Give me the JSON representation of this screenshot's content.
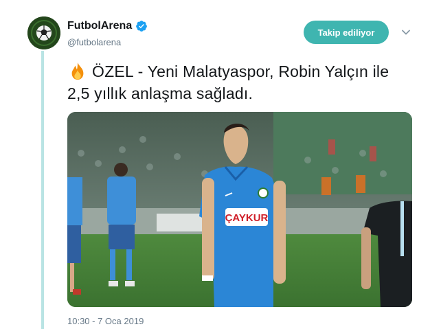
{
  "account": {
    "display_name": "FutbolArena",
    "handle": "@futbolarena",
    "verified": true,
    "avatar_icon": "soccer-ball-icon"
  },
  "actions": {
    "follow_label": "Takip ediliyor",
    "more_icon": "chevron-down-icon"
  },
  "tweet": {
    "emoji_icon": "fire-icon",
    "text": "ÖZEL - Yeni Malatyaspor, Robin Yalçın ile 2,5 yıllık anlaşma sağladı.",
    "timestamp": "10:30 - 7 Oca 2019"
  },
  "media": {
    "jersey_sponsor": "ÇAYKUR"
  },
  "colors": {
    "accent": "#3fb5b0",
    "thread_line": "#b9e4e4",
    "verified": "#1da1f2",
    "secondary_text": "#657786"
  }
}
